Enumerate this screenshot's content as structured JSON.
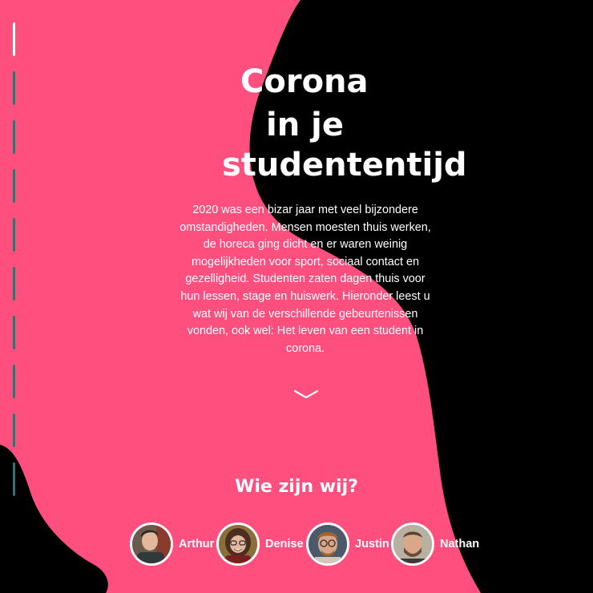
{
  "hero": {
    "title_line1": "Corona",
    "title_line2": "in je",
    "title_line3": "studententijd",
    "intro": "2020 was een bizar jaar met veel bijzondere omstandigheden. Mensen moesten thuis werken, de horeca ging dicht en er waren weinig mogelijkheden voor sport, sociaal contact en gezelligheid. Studenten zaten dagen thuis voor hun lessen, stage en huiswerk. Hieronder leest u wat wij van de verschillende gebeurtenissen vonden, ook wel: Het leven van een student in corona.",
    "scroll_icon": "chevron-down-icon"
  },
  "team": {
    "heading": "Wie zijn wij?",
    "members": [
      {
        "name": "Arthur",
        "icon": "avatar-photo"
      },
      {
        "name": "Denise",
        "icon": "avatar-photo"
      },
      {
        "name": "Justin",
        "icon": "avatar-photo"
      },
      {
        "name": "Nathan",
        "icon": "avatar-photo"
      }
    ]
  },
  "timeline": {
    "icon": "timeline-dash-icon"
  },
  "colors": {
    "pink": "#fe4f7f",
    "black": "#000000",
    "timeline_dash": "#3f6d6b",
    "text": "#ffffff"
  }
}
